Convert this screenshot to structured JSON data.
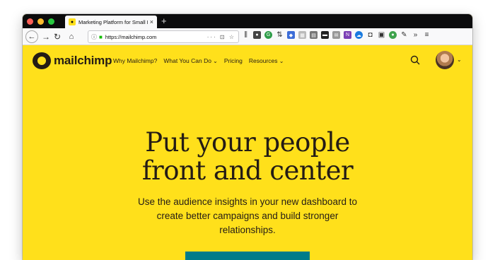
{
  "browser": {
    "tab_title": "Marketing Platform for Small Bu",
    "tab_close": "×",
    "new_tab": "+",
    "url": "https://mailchimp.com",
    "url_extras": "··· ⊡ ☆"
  },
  "site": {
    "wordmark": "mailchimp",
    "nav": [
      "Why Mailchimp?",
      "What You Can Do",
      "Pricing",
      "Resources"
    ]
  },
  "hero": {
    "headline_line1": "Put your people",
    "headline_line2": "front and center",
    "subtext": "Use the audience insights in your new dashboard to create better campaigns and build stronger relationships."
  },
  "colors": {
    "brand_yellow": "#ffe01b",
    "cta_teal": "#007c89",
    "text_dark": "#241c15"
  },
  "icons": [
    "back-icon",
    "forward-icon",
    "reload-icon",
    "home-icon",
    "lock-icon",
    "search-icon"
  ]
}
